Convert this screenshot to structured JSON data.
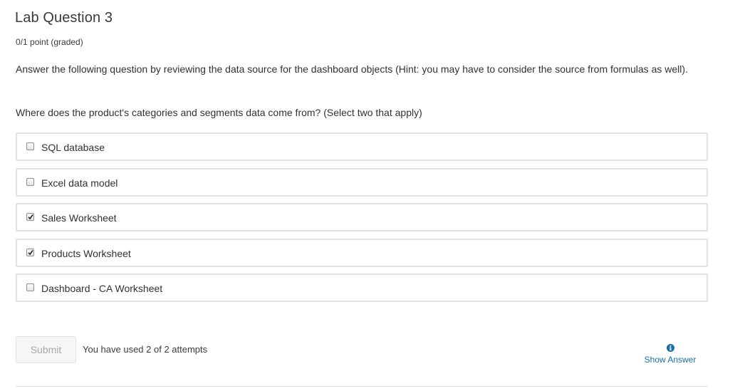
{
  "problem": {
    "title": "Lab Question 3",
    "score": "0/1 point (graded)",
    "prompt": "Answer the following question by reviewing the data source for the dashboard objects (Hint: you may have to consider the source from formulas as well).",
    "question": "Where does the product's categories and segments data come from? (Select two that apply)"
  },
  "choices": [
    {
      "label": "SQL database",
      "checked": false
    },
    {
      "label": "Excel data model",
      "checked": false
    },
    {
      "label": "Sales Worksheet",
      "checked": true
    },
    {
      "label": "Products Worksheet",
      "checked": true
    },
    {
      "label": "Dashboard - CA Worksheet",
      "checked": false
    }
  ],
  "actions": {
    "submit_label": "Submit",
    "attempts_text": "You have used 2 of 2 attempts",
    "show_answer_label": "Show Answer",
    "show_answer_icon": "info-icon"
  },
  "colors": {
    "link": "#1a6ea8",
    "border": "#e2e2e2",
    "submit_disabled_text": "#a9a9a9"
  }
}
